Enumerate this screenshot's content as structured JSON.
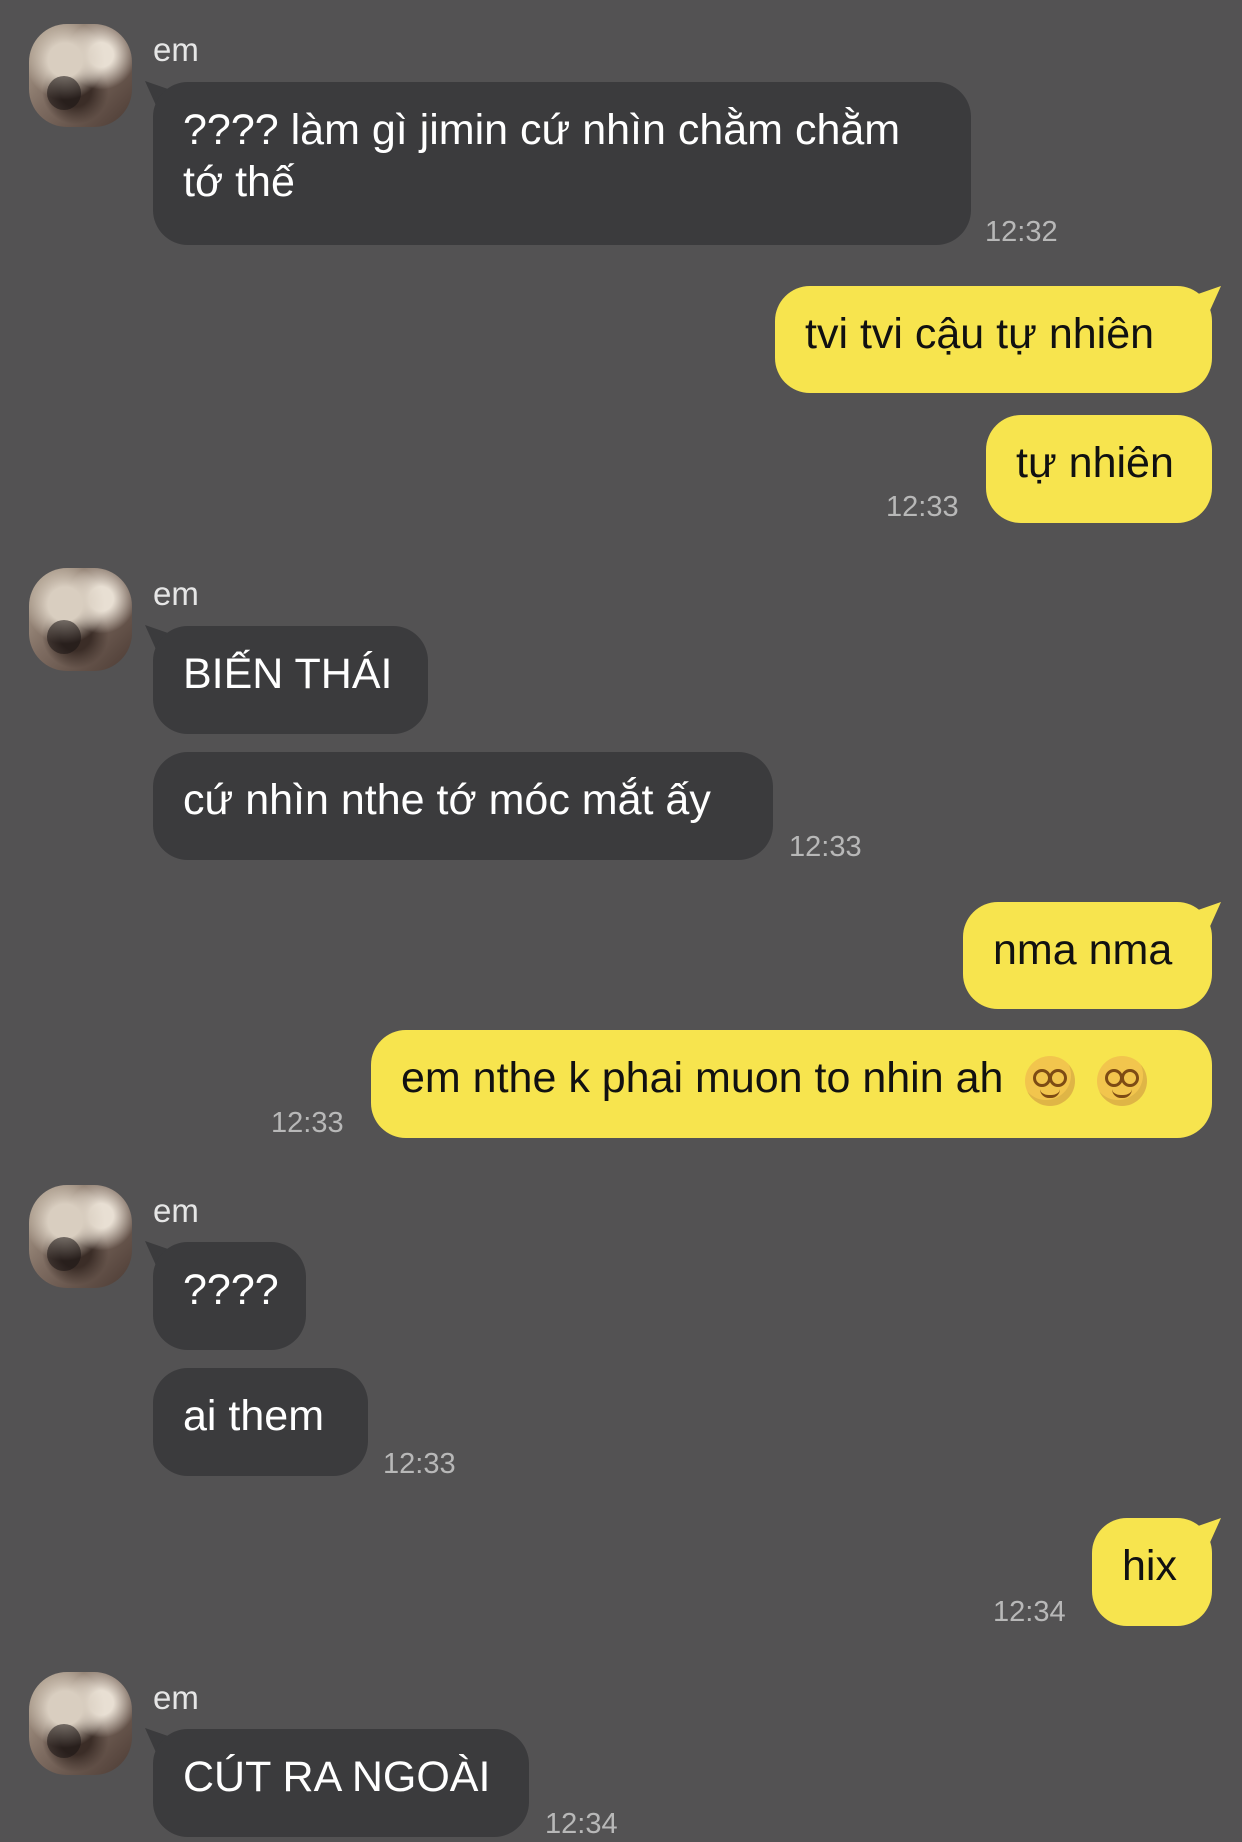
{
  "chat": {
    "contact_name": "em",
    "messages": [
      {
        "from": "in",
        "text": "???? làm gì jimin cứ nhìn chằm chằm tớ thế",
        "time": "12:32"
      },
      {
        "from": "out",
        "text": "tvi tvi cậu tự nhiên",
        "time": ""
      },
      {
        "from": "out",
        "text": "tự nhiên",
        "time": "12:33"
      },
      {
        "from": "in",
        "text": "BIẾN THÁI",
        "time": ""
      },
      {
        "from": "in",
        "text": "cứ nhìn nthe tớ móc mắt ấy",
        "time": "12:33"
      },
      {
        "from": "out",
        "text": "nma nma",
        "time": ""
      },
      {
        "from": "out",
        "text": "em nthe k phai muon to nhin ah",
        "time": "12:33"
      },
      {
        "from": "in",
        "text": "????",
        "time": ""
      },
      {
        "from": "in",
        "text": "ai them",
        "time": "12:33"
      },
      {
        "from": "out",
        "text": "hix",
        "time": "12:34"
      },
      {
        "from": "in",
        "text": "CÚT RA NGOÀI",
        "time": "12:34"
      }
    ]
  },
  "emoji": {
    "name": "dizzy-face-emoji",
    "count": 2
  }
}
